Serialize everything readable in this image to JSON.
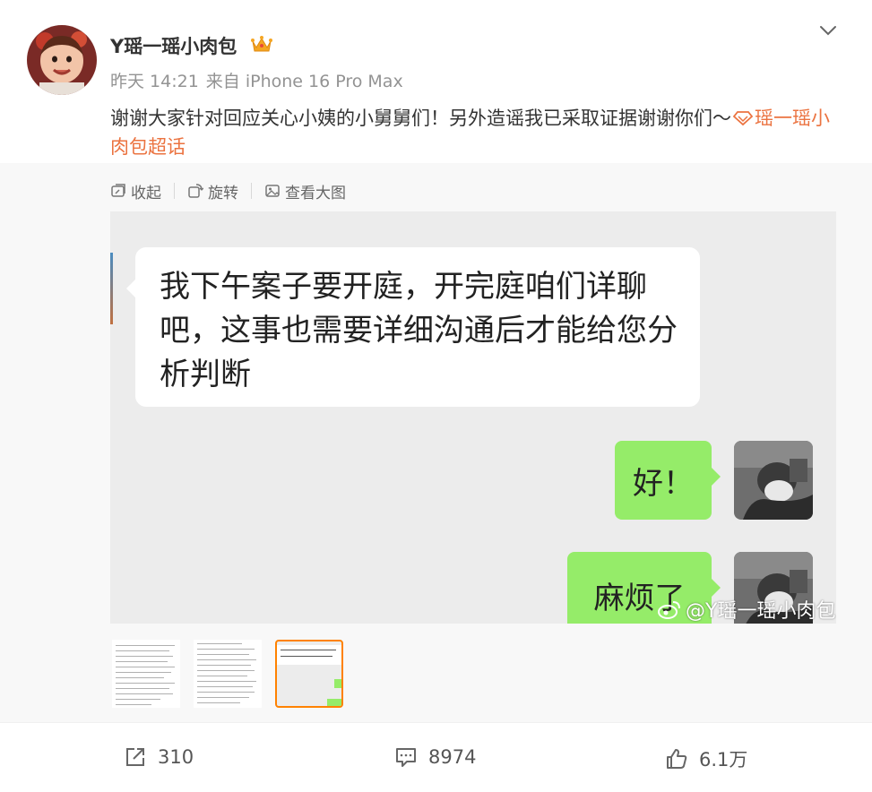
{
  "post": {
    "username": "Y瑶一瑶小肉包",
    "time": "昨天 14:21",
    "source": "来自 iPhone 16 Pro Max",
    "text": "谢谢大家针对回应关心小姨的小舅舅们！另外造谣我已采取证据谢谢你们～",
    "topic": "瑶一瑶小肉包超话"
  },
  "toolbar": {
    "collapse": "收起",
    "rotate": "旋转",
    "view_large": "查看大图"
  },
  "chat": {
    "incoming": "我下午案子要开庭，开完庭咱们详聊吧，这事也需要详细沟通后才能给您分析判断",
    "reply1": "好！",
    "reply2": "麻烦了",
    "watermark": "@Y瑶一瑶小肉包"
  },
  "footer": {
    "repost_count": "310",
    "comment_count": "8974",
    "like_count": "6.1万"
  },
  "colors": {
    "topic": "#eb7340",
    "bubble_green": "#95ec69",
    "thumb_selected": "#ff8200"
  }
}
